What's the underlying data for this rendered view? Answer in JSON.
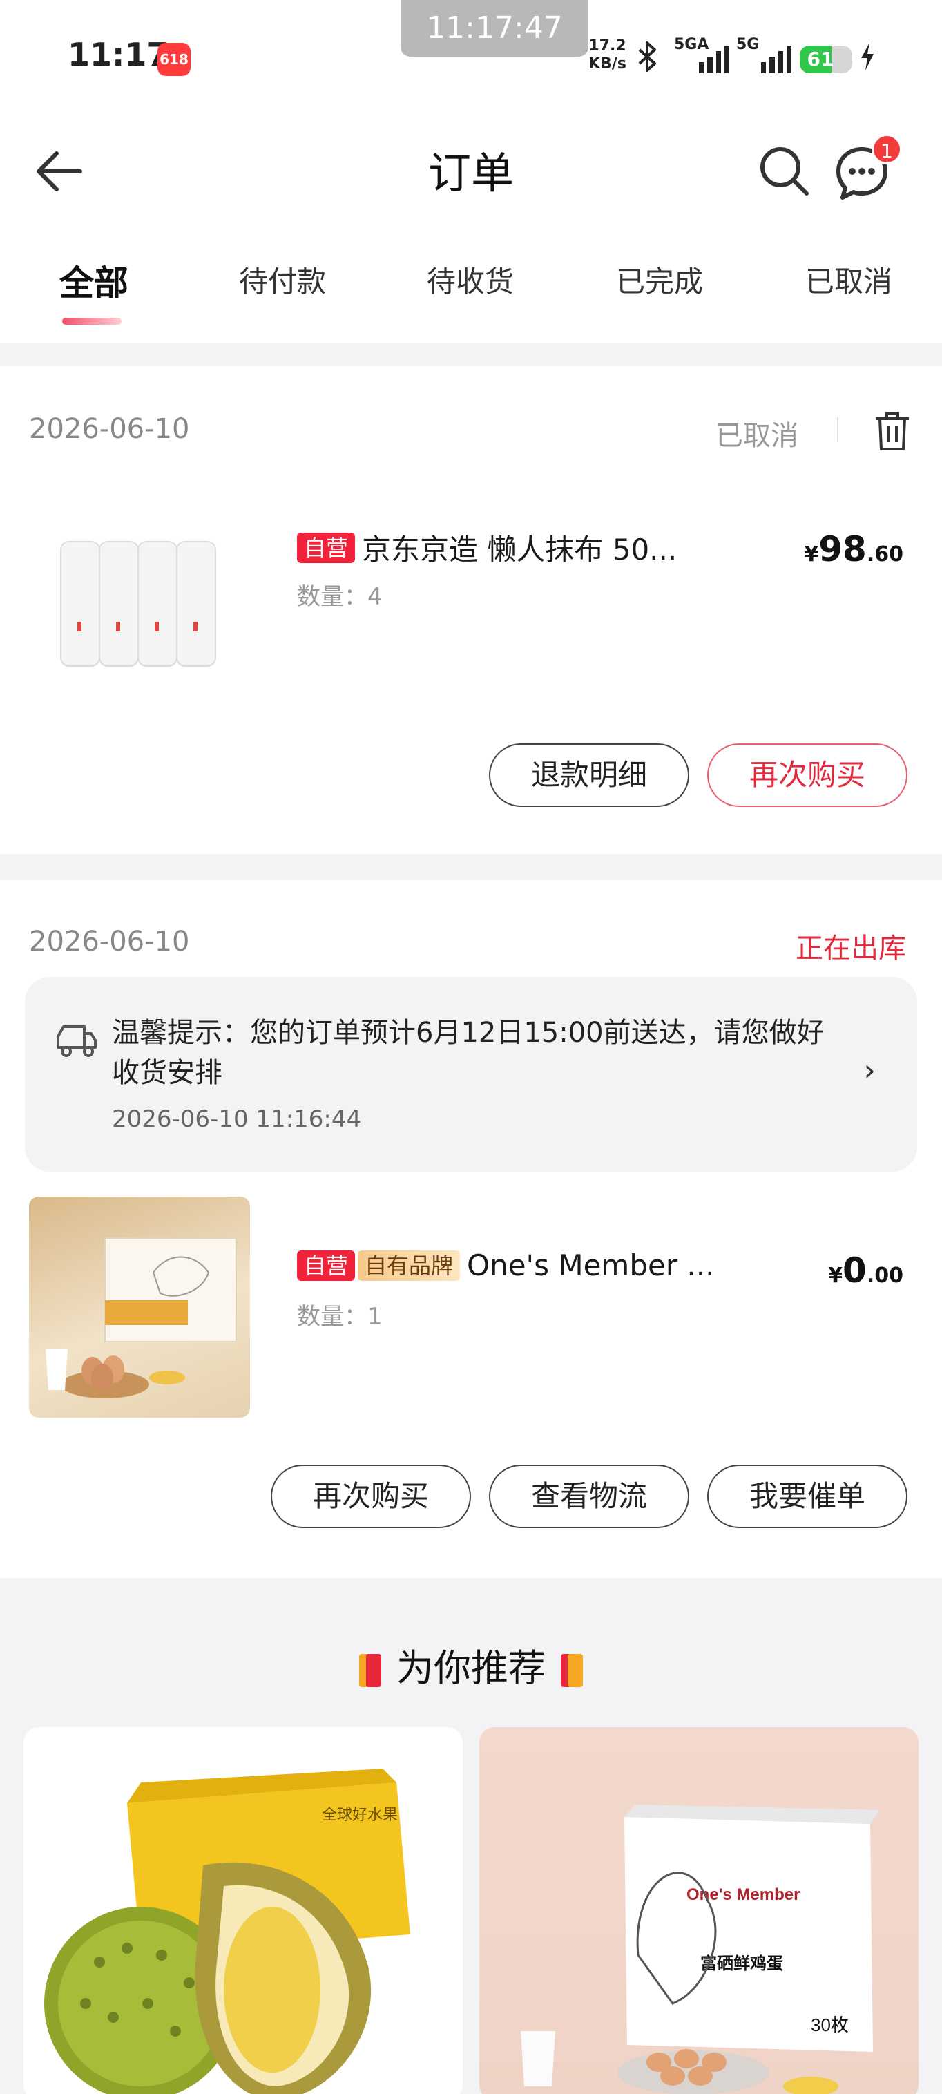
{
  "status_bar": {
    "time": "11:17",
    "app_badge": "618",
    "overlay_time": "11:17:47",
    "network_speed": "17.2",
    "network_unit": "KB/s",
    "sim1_label": "5GA",
    "sim2_label": "5G",
    "battery": "61",
    "battery_level": 0.61
  },
  "header": {
    "title": "订单",
    "message_count": "1"
  },
  "tabs": [
    "全部",
    "待付款",
    "待收货",
    "已完成",
    "已取消"
  ],
  "orders": [
    {
      "date": "2026-06-10",
      "status": "已取消",
      "tags": [
        "自营"
      ],
      "product_name": "京东京造 懒人抹布 50...",
      "quantity": "数量：4",
      "price_currency": "¥",
      "price_int": "98",
      "price_dec": ".60",
      "buttons": [
        "退款明细",
        "再次购买"
      ]
    },
    {
      "date": "2026-06-10",
      "status": "正在出库",
      "notice_text": "温馨提示：您的订单预计6月12日15:00前送达，请您做好收货安排",
      "notice_time": "2026-06-10 11:16:44",
      "tags": [
        "自营",
        "自有品牌"
      ],
      "product_name": "One's Member ...",
      "quantity": "数量：1",
      "price_currency": "¥",
      "price_int": "0",
      "price_dec": ".00",
      "buttons": [
        "再次购买",
        "查看物流",
        "我要催单"
      ]
    }
  ],
  "recommend": {
    "title": "为你推荐",
    "item1_box_text": "全球好水果",
    "item2_brand": "One's Member",
    "item2_product": "富硒鲜鸡蛋",
    "item2_count": "30枚"
  },
  "colors": {
    "accent_red": "#e22a3f",
    "tag_red": "#f0233b",
    "battery_green": "#2fc84b"
  }
}
